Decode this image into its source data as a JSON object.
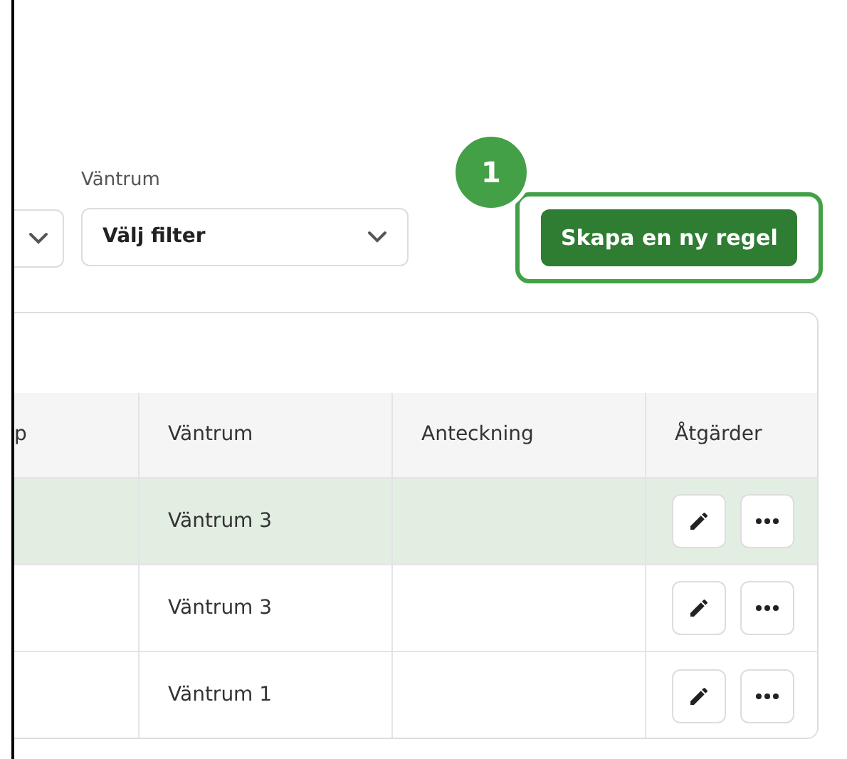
{
  "filter": {
    "label": "Väntrum",
    "value": "Välj filter"
  },
  "callout": {
    "number": "1"
  },
  "create_button": {
    "label": "Skapa en ny regel"
  },
  "table": {
    "columns": [
      "p",
      "Väntrum",
      "Anteckning",
      "Åtgärder"
    ],
    "rows": [
      {
        "waiting_room": "Väntrum 3",
        "selected": true
      },
      {
        "waiting_room": "Väntrum 3",
        "selected": false
      },
      {
        "waiting_room": "Väntrum 1",
        "selected": false
      }
    ]
  }
}
